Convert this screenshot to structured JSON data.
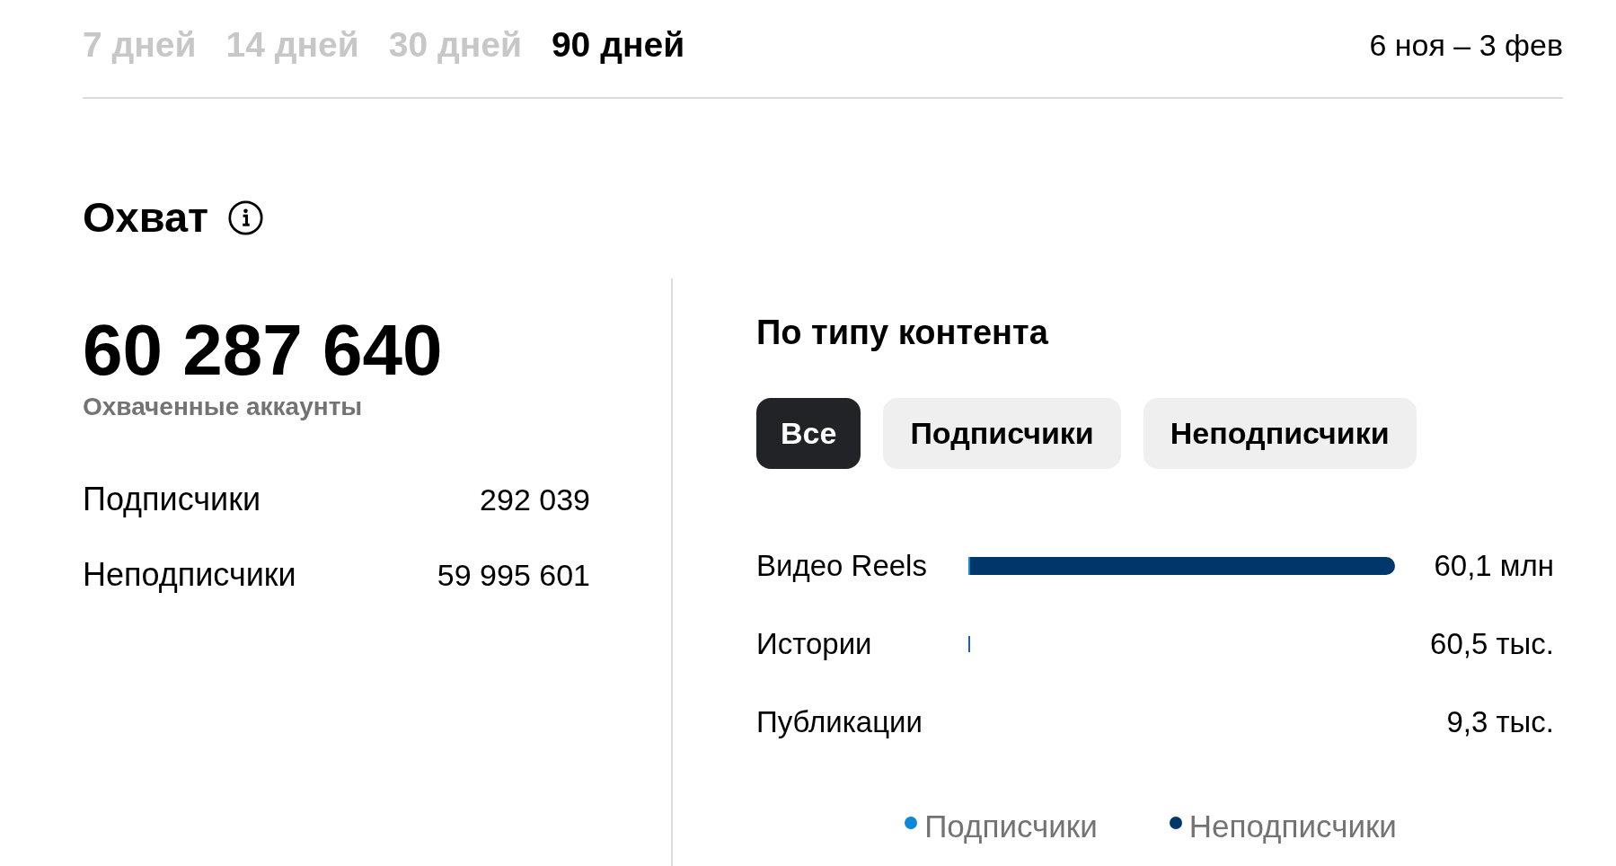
{
  "period_tabs": [
    {
      "label": "7 дней",
      "selected": false
    },
    {
      "label": "14 дней",
      "selected": false
    },
    {
      "label": "30 дней",
      "selected": false
    },
    {
      "label": "90 дней",
      "selected": true
    }
  ],
  "date_range": "6 ноя – 3 фев",
  "reach": {
    "title": "Охват",
    "total": "60 287 640",
    "total_label": "Охваченные аккаунты",
    "breakdown": [
      {
        "label": "Подписчики",
        "value": "292 039"
      },
      {
        "label": "Неподписчики",
        "value": "59 995 601"
      }
    ]
  },
  "content_type": {
    "title": "По типу контента",
    "filters": [
      {
        "label": "Все",
        "selected": true
      },
      {
        "label": "Подписчики",
        "selected": false
      },
      {
        "label": "Неподписчики",
        "selected": false
      }
    ],
    "bars": [
      {
        "label": "Видео Reels",
        "value": "60,1 млн",
        "stub": false,
        "segments": [
          {
            "level": 0.005,
            "color": "#1a8ad4"
          },
          {
            "level": 0.995,
            "color": "#00376b"
          }
        ]
      },
      {
        "label": "Истории",
        "value": "60,5 тыс.",
        "stub": true
      },
      {
        "label": "Публикации",
        "value": "9,3 тыс.",
        "stub": false
      }
    ],
    "legend": [
      {
        "label": "Подписчики",
        "color": "#0c8ad9"
      },
      {
        "label": "Неподписчики",
        "color": "#00376b"
      }
    ]
  }
}
